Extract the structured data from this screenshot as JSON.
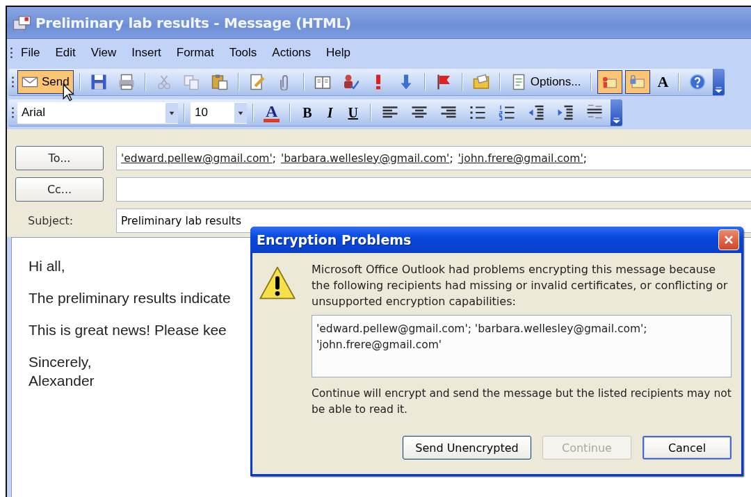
{
  "window": {
    "title": "Preliminary lab results - Message (HTML)"
  },
  "menu": [
    "File",
    "Edit",
    "View",
    "Insert",
    "Format",
    "Tools",
    "Actions",
    "Help"
  ],
  "standard_toolbar": {
    "send": {
      "label": "Send",
      "highlighted": true
    },
    "options": {
      "label": "Options..."
    },
    "toggles": [
      {
        "on": true
      },
      {
        "on": true
      }
    ],
    "grow_font_glyph": "A"
  },
  "formatting_toolbar": {
    "font": "Arial",
    "size": "10",
    "font_color_glyph": "A",
    "styles": [
      "B",
      "I",
      "U"
    ]
  },
  "header": {
    "fields": [
      {
        "kind": "button",
        "label": "To...",
        "recipients": [
          {
            "address": "'edward.pellew@gmail.com'",
            "separator": ";"
          },
          {
            "address": "'barbara.wellesley@gmail.com'",
            "separator": ";"
          },
          {
            "address": "'john.frere@gmail.com'",
            "separator": ";"
          }
        ]
      },
      {
        "kind": "button",
        "label": "Cc..."
      },
      {
        "kind": "label",
        "label": "Subject:",
        "value": "Preliminary lab results"
      }
    ]
  },
  "body": {
    "paragraphs": [
      "Hi all,",
      "The preliminary results indicate",
      "This is great news!  Please kee",
      "Sincerely,\nAlexander"
    ]
  },
  "dialog": {
    "title": "Encryption Problems",
    "message": "Microsoft Office Outlook had problems encrypting this message because the following recipients had missing or invalid certificates, or conflicting or unsupported encryption capabilities:",
    "recipients": "'edward.pellew@gmail.com'; 'barbara.wellesley@gmail.com';\n'john.frere@gmail.com'",
    "note": "Continue will encrypt and send the message but the listed recipients may not be able to read it.",
    "buttons": [
      {
        "label": "Send Unencrypted",
        "disabled": false,
        "default": false
      },
      {
        "label": "Continue",
        "disabled": true,
        "default": false
      },
      {
        "label": "Cancel",
        "disabled": false,
        "default": true
      }
    ]
  }
}
